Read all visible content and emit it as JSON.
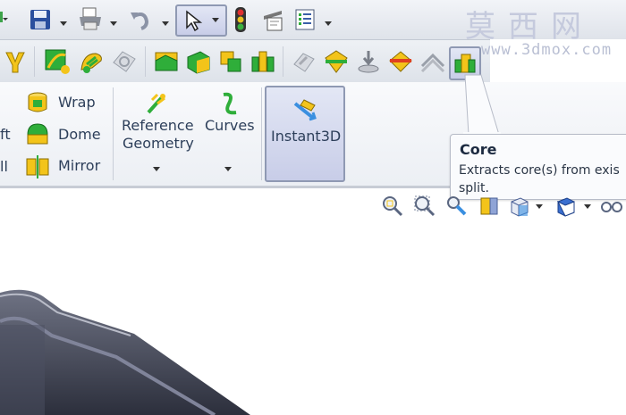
{
  "watermark": {
    "line1": "莫西网",
    "line2": "www.3dmox.com"
  },
  "ribbon": {
    "wrap_label": "Wrap",
    "dome_label": "Dome",
    "mirror_label": "Mirror",
    "loft_partial": "ft",
    "shell_partial": "ll",
    "reference_geometry_label": [
      "Reference",
      "Geometry"
    ],
    "curves_label": "Curves",
    "instant3d_label": "Instant3D"
  },
  "tooltip": {
    "title": "Core",
    "description_line1": "Extracts core(s) from exis",
    "description_line2": "split."
  },
  "colors": {
    "accent_yellow": "#f3c41a",
    "accent_green": "#2fae3a",
    "ribbon_text": "#2d3f5a"
  }
}
